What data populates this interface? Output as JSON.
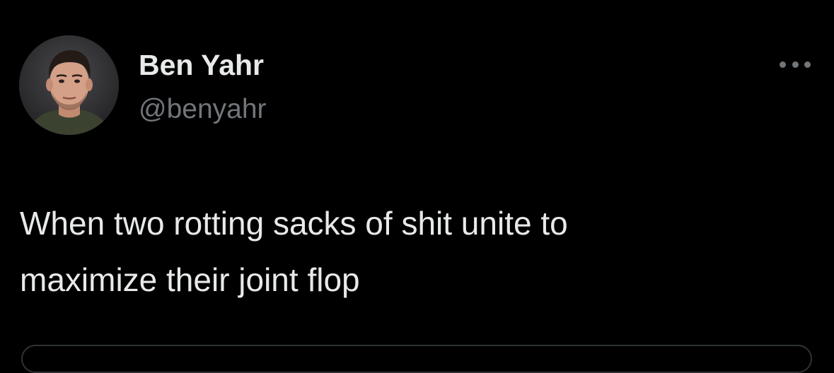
{
  "author": {
    "display_name": "Ben Yahr",
    "handle": "@benyahr",
    "avatar_icon": "profile-photo"
  },
  "tweet": {
    "text_lines": [
      "When two rotting sacks of shit unite to",
      "maximize their joint flop"
    ]
  },
  "menu": {
    "more_icon": "ellipsis-horizontal-icon"
  },
  "colors": {
    "background": "#000000",
    "primary_text": "#e7e9ea",
    "secondary_text": "#71767b",
    "border": "#2f3336"
  }
}
